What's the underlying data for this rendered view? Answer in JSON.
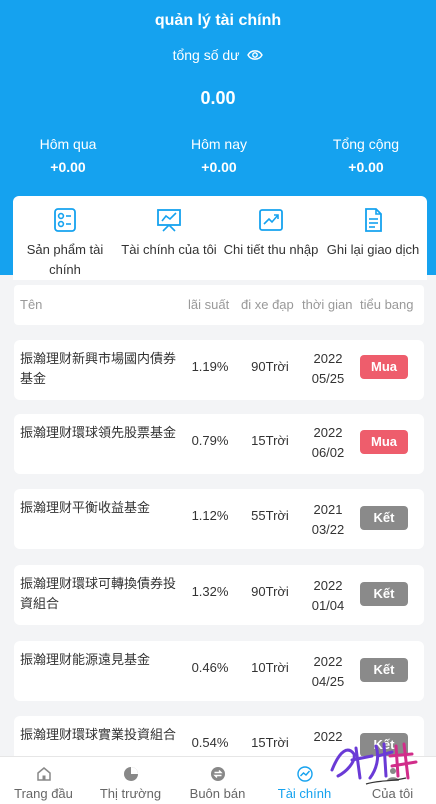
{
  "header": {
    "title": "quản lý tài chính",
    "balance_label": "tổng số dư",
    "balance_value": "0.00",
    "stats": [
      {
        "label": "Hôm qua",
        "value": "+0.00"
      },
      {
        "label": "Hôm nay",
        "value": "+0.00"
      },
      {
        "label": "Tổng cộng",
        "value": "+0.00"
      }
    ]
  },
  "menu": [
    {
      "label": "Sản phẩm tài chính",
      "icon": "product-list-icon"
    },
    {
      "label": "Tài chính của tôi",
      "icon": "chart-board-icon"
    },
    {
      "label": "Chi tiết thu nhập",
      "icon": "trend-up-icon"
    },
    {
      "label": "Ghi lại giao dịch",
      "icon": "document-icon"
    }
  ],
  "table": {
    "headers": {
      "name": "Tên",
      "rate": "lãi suất",
      "period": "đi xe đạp",
      "time": "thời gian",
      "status": "tiểu bang"
    },
    "rows": [
      {
        "name": "振瀚理财新興市場國内債券基金",
        "rate": "1.19%",
        "days": "90Trời",
        "year": "2022",
        "date": "05/25",
        "action": "Mua",
        "status": "buy"
      },
      {
        "name": "振瀚理财環球領先股票基金",
        "rate": "0.79%",
        "days": "15Trời",
        "year": "2022",
        "date": "06/02",
        "action": "Mua",
        "status": "buy"
      },
      {
        "name": "振瀚理财平衡收益基金",
        "rate": "1.12%",
        "days": "55Trời",
        "year": "2021",
        "date": "03/22",
        "action": "Kết",
        "status": "done"
      },
      {
        "name": "振瀚理财環球可轉換債券投資組合",
        "rate": "1.32%",
        "days": "90Trời",
        "year": "2022",
        "date": "01/04",
        "action": "Kết",
        "status": "done"
      },
      {
        "name": "振瀚理财能源遠見基金",
        "rate": "0.46%",
        "days": "10Trời",
        "year": "2022",
        "date": "04/25",
        "action": "Kết",
        "status": "done"
      },
      {
        "name": "振瀚理财環球實業投資組合",
        "rate": "0.54%",
        "days": "15Trời",
        "year": "2022",
        "date": "",
        "action": "Kết",
        "status": "done"
      }
    ]
  },
  "tabbar": [
    {
      "label": "Trang đầu",
      "icon": "home-icon",
      "active": false
    },
    {
      "label": "Thị trường",
      "icon": "pie-chart-icon",
      "active": false
    },
    {
      "label": "Buôn bán",
      "icon": "exchange-icon",
      "active": false
    },
    {
      "label": "Tài chính",
      "icon": "finance-trend-icon",
      "active": true
    },
    {
      "label": "Của tôi",
      "icon": "user-icon",
      "active": false
    }
  ],
  "colors": {
    "primary": "#15a2ef",
    "buy": "#ee5d6c",
    "done": "#8a8a8a",
    "background": "#f3f4f6"
  }
}
